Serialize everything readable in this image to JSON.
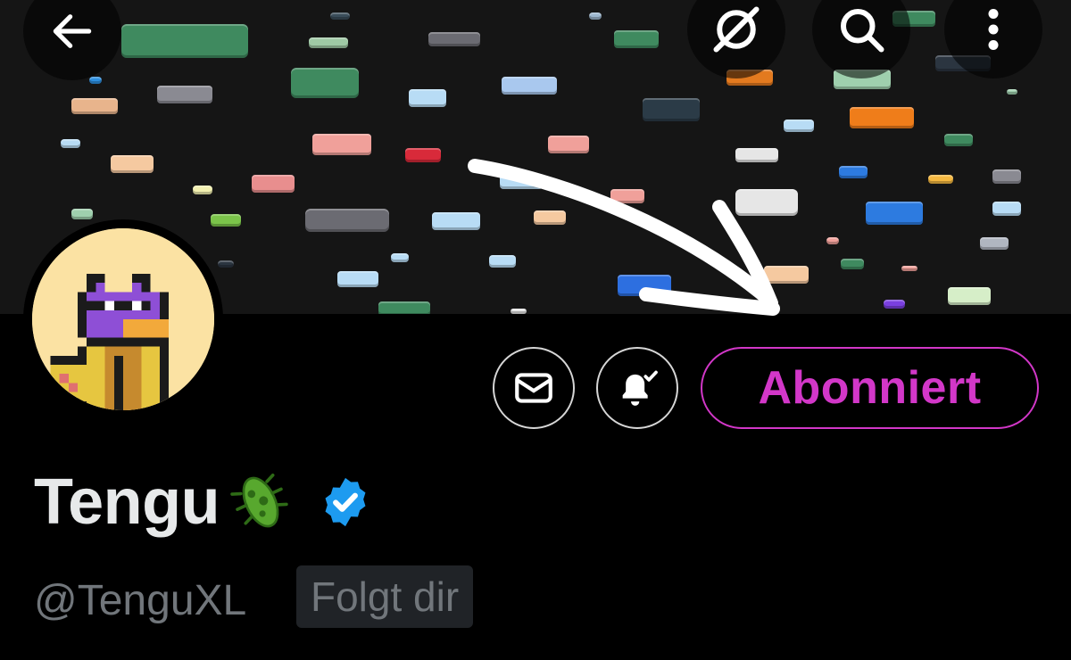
{
  "profile": {
    "display_name": "Tengu",
    "handle": "@TenguXL",
    "follows_you_badge": "Folgt dir",
    "verified": true,
    "name_emoji": "microbe-icon"
  },
  "actions": {
    "follow_button_label": "Abonniert",
    "follow_button_color": "#d237c8",
    "message_icon": "envelope-icon",
    "notification_icon": "bell-check-icon"
  },
  "top_bar": {
    "back_icon": "arrow-left-icon",
    "grok_icon": "grok-icon",
    "search_icon": "search-icon",
    "more_icon": "more-vertical-icon"
  },
  "colors": {
    "background": "#000000",
    "verified_badge": "#1d9bf0",
    "annotation_arrow": "#ffffff"
  }
}
